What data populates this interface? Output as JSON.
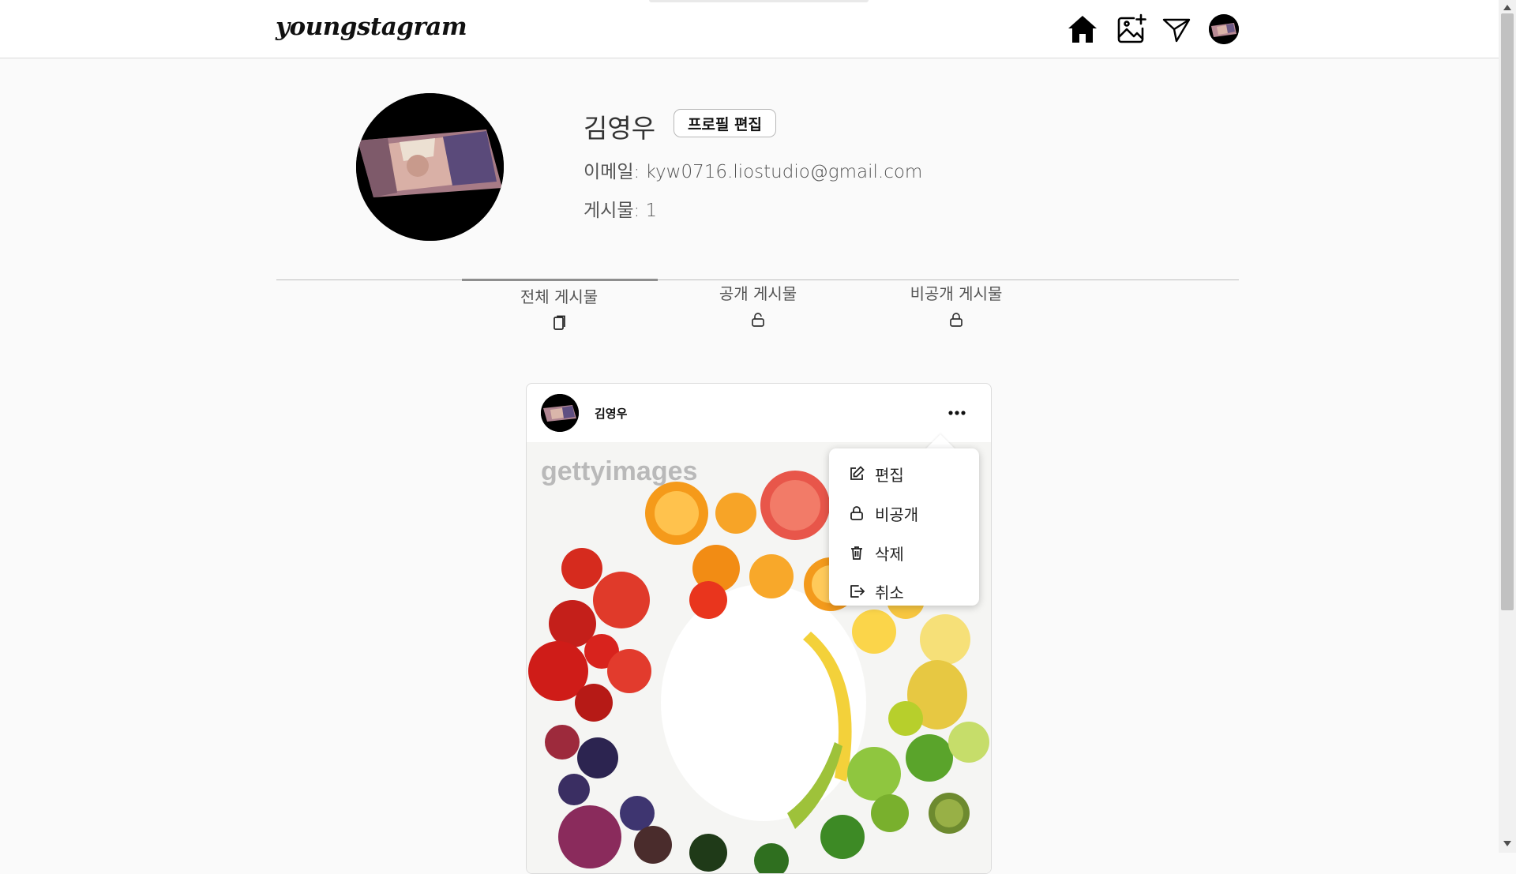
{
  "header": {
    "logo": "youngstagram",
    "nav": [
      "home-icon",
      "add-photo-icon",
      "send-icon",
      "avatar"
    ]
  },
  "profile": {
    "name": "김영우",
    "edit_button": "프로필 편집",
    "email_label": "이메일:",
    "email": "kyw0716.liostudio@gmail.com",
    "posts_label": "게시물:",
    "posts_count": "1"
  },
  "tabs": [
    {
      "label": "전체 게시물",
      "icon": "copy-icon",
      "active": true
    },
    {
      "label": "공개 게시물",
      "icon": "unlock-icon",
      "active": false
    },
    {
      "label": "비공개 게시물",
      "icon": "lock-icon",
      "active": false
    }
  ],
  "post": {
    "username": "김영우",
    "image_watermark": "gettyimages"
  },
  "menu": {
    "items": [
      {
        "label": "편집",
        "icon": "edit-icon"
      },
      {
        "label": "비공개",
        "icon": "lock-icon"
      },
      {
        "label": "삭제",
        "icon": "trash-icon"
      },
      {
        "label": "취소",
        "icon": "logout-icon"
      }
    ]
  },
  "colors": {
    "background": "#fafafa",
    "header": "#ffffff",
    "border": "#dbdbdb",
    "text": "#262626",
    "active_tab_bar": "#8e8e8e"
  }
}
